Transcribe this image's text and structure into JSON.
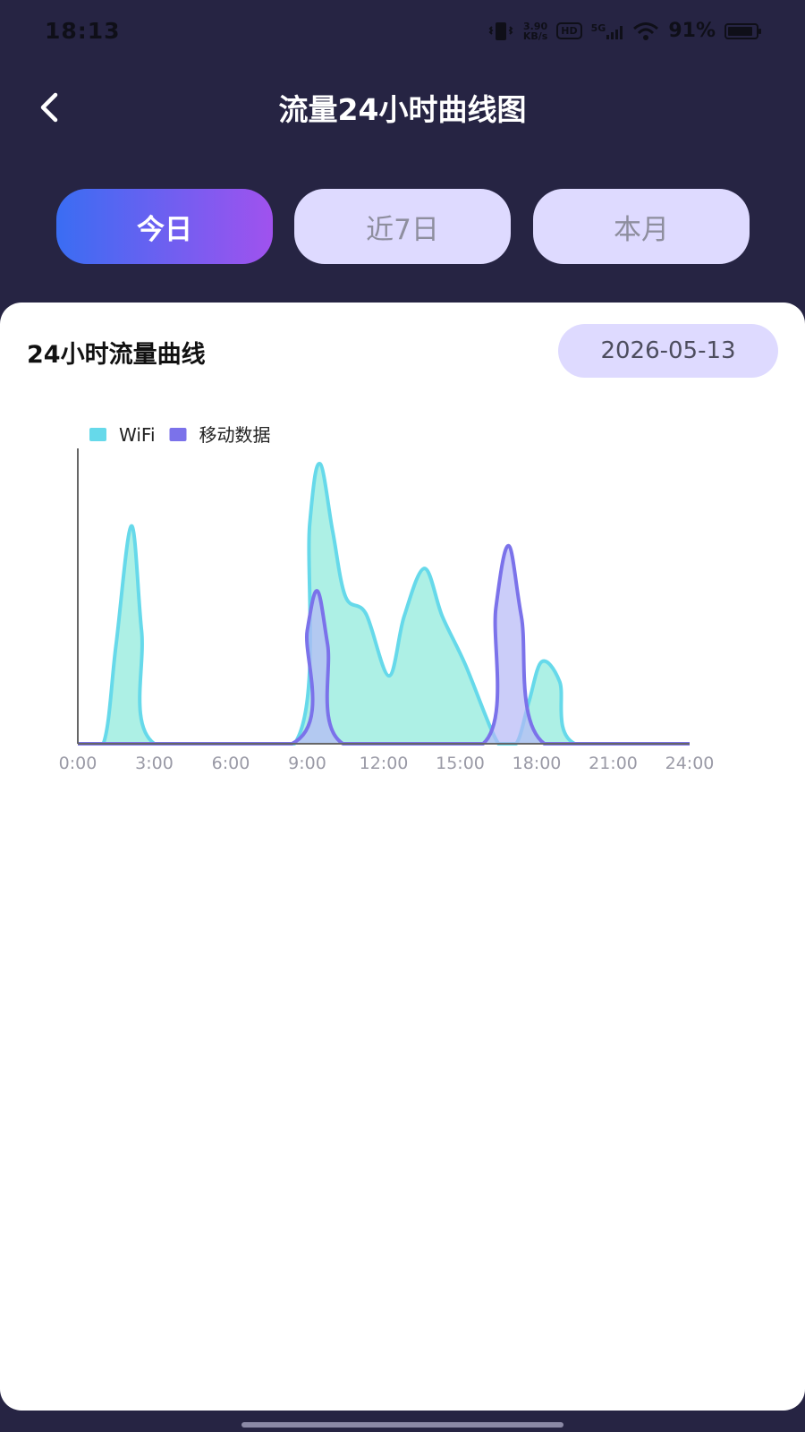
{
  "status_bar": {
    "time": "18:13",
    "net_speed_value": "3.90",
    "net_speed_unit": "KB/s",
    "hd_label": "HD",
    "network_label": "5G",
    "battery_percent": "91%",
    "battery_level": 0.91,
    "icons": [
      "vibrate-icon",
      "hd-icon",
      "signal-5g-icon",
      "wifi-icon",
      "battery-icon"
    ]
  },
  "header": {
    "back_icon": "chevron-left-icon",
    "title": "流量24小时曲线图"
  },
  "tabs": [
    {
      "label": "今日",
      "active": true
    },
    {
      "label": "近7日",
      "active": false
    },
    {
      "label": "本月",
      "active": false
    }
  ],
  "card": {
    "title": "24小时流量曲线",
    "date": "2026-05-13"
  },
  "colors": {
    "header_bg": "#262443",
    "tab_active_start": "#3a6df3",
    "tab_active_end": "#a052ee",
    "tab_inactive": "#dedaff",
    "wifi": "#66d9ea",
    "mobile": "#7b72ea"
  },
  "chart_data": {
    "type": "area",
    "title": "",
    "xlabel": "",
    "ylabel": "",
    "x_ticks": [
      "0:00",
      "3:00",
      "6:00",
      "9:00",
      "12:00",
      "15:00",
      "18:00",
      "21:00",
      "24:00"
    ],
    "xlim": [
      0,
      24
    ],
    "ylim": [
      0,
      100
    ],
    "legend_position": "top-left",
    "grid": false,
    "series": [
      {
        "name": "WiFi",
        "color": "#66d9ea",
        "fill": "#a9efe4",
        "points": [
          [
            0,
            0
          ],
          [
            1.0,
            0
          ],
          [
            1.5,
            35
          ],
          [
            2.1,
            77
          ],
          [
            2.5,
            40
          ],
          [
            3.0,
            0
          ],
          [
            8.5,
            0
          ],
          [
            9.1,
            78
          ],
          [
            9.5,
            99
          ],
          [
            10.0,
            75
          ],
          [
            10.5,
            52
          ],
          [
            11.3,
            46
          ],
          [
            12.2,
            24
          ],
          [
            12.8,
            45
          ],
          [
            13.6,
            62
          ],
          [
            14.3,
            45
          ],
          [
            15.2,
            28
          ],
          [
            16.5,
            0
          ],
          [
            17.2,
            0
          ],
          [
            17.7,
            15
          ],
          [
            18.2,
            29
          ],
          [
            18.9,
            22
          ],
          [
            19.5,
            0
          ],
          [
            24,
            0
          ]
        ]
      },
      {
        "name": "移动数据",
        "color": "#7b72ea",
        "fill": "#b5b8f7",
        "points": [
          [
            0,
            0
          ],
          [
            8.4,
            0
          ],
          [
            9.0,
            40
          ],
          [
            9.4,
            54
          ],
          [
            9.8,
            35
          ],
          [
            10.4,
            0
          ],
          [
            15.9,
            0
          ],
          [
            16.4,
            48
          ],
          [
            16.9,
            70
          ],
          [
            17.4,
            45
          ],
          [
            18.3,
            0
          ],
          [
            24,
            0
          ]
        ]
      }
    ]
  }
}
